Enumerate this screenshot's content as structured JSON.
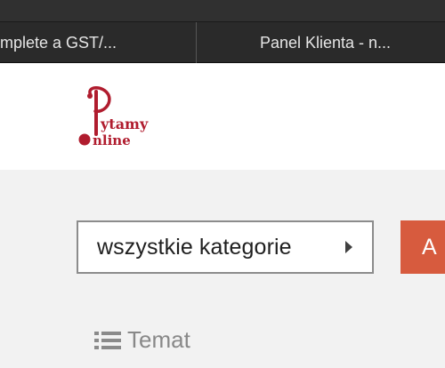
{
  "browser": {
    "tabs": [
      {
        "label": "omplete a GST/..."
      },
      {
        "label": "Panel Klienta - n..."
      }
    ]
  },
  "header": {
    "logo": {
      "line1": "ytamy",
      "line2": "nline",
      "color": "#b01c2e"
    }
  },
  "filter": {
    "category_label": "wszystkie kategorie",
    "action_label": "A",
    "action_color": "#d75b3e"
  },
  "list": {
    "column_label": "Temat",
    "icon": "list-icon"
  }
}
